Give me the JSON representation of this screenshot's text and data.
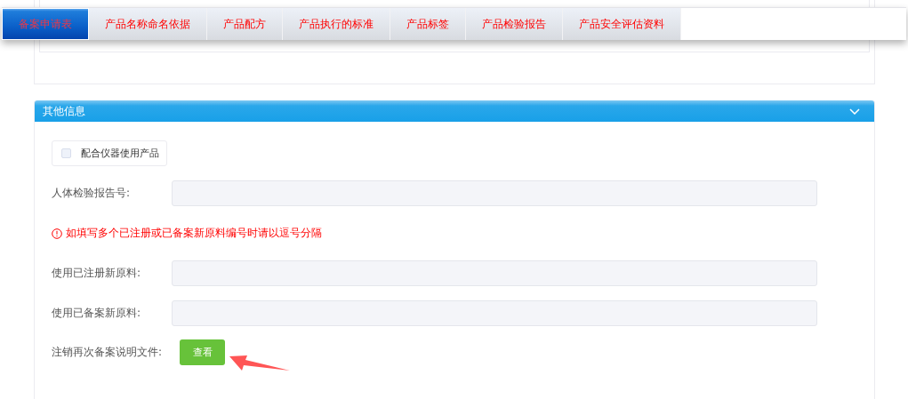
{
  "tabs": [
    {
      "label": "备案申请表",
      "selected": true
    },
    {
      "label": "产品名称命名依据",
      "selected": false
    },
    {
      "label": "产品配方",
      "selected": false
    },
    {
      "label": "产品执行的标准",
      "selected": false
    },
    {
      "label": "产品标签",
      "selected": false
    },
    {
      "label": "产品检验报告",
      "selected": false
    },
    {
      "label": "产品安全评估资料",
      "selected": false
    }
  ],
  "section": {
    "title": "其他信息",
    "expanded": true,
    "checkbox": {
      "label": "配合仪器使用产品",
      "checked": false
    },
    "fields": [
      {
        "kind": "input",
        "label": "人体检验报告号:"
      },
      {
        "kind": "warning",
        "text": "如填写多个已注册或已备案新原料编号时请以逗号分隔"
      },
      {
        "kind": "input",
        "label": "使用已注册新原料:"
      },
      {
        "kind": "input",
        "label": "使用已备案新原料:"
      },
      {
        "kind": "button",
        "label": "注销再次备案说明文件:",
        "button": "查看"
      }
    ]
  }
}
